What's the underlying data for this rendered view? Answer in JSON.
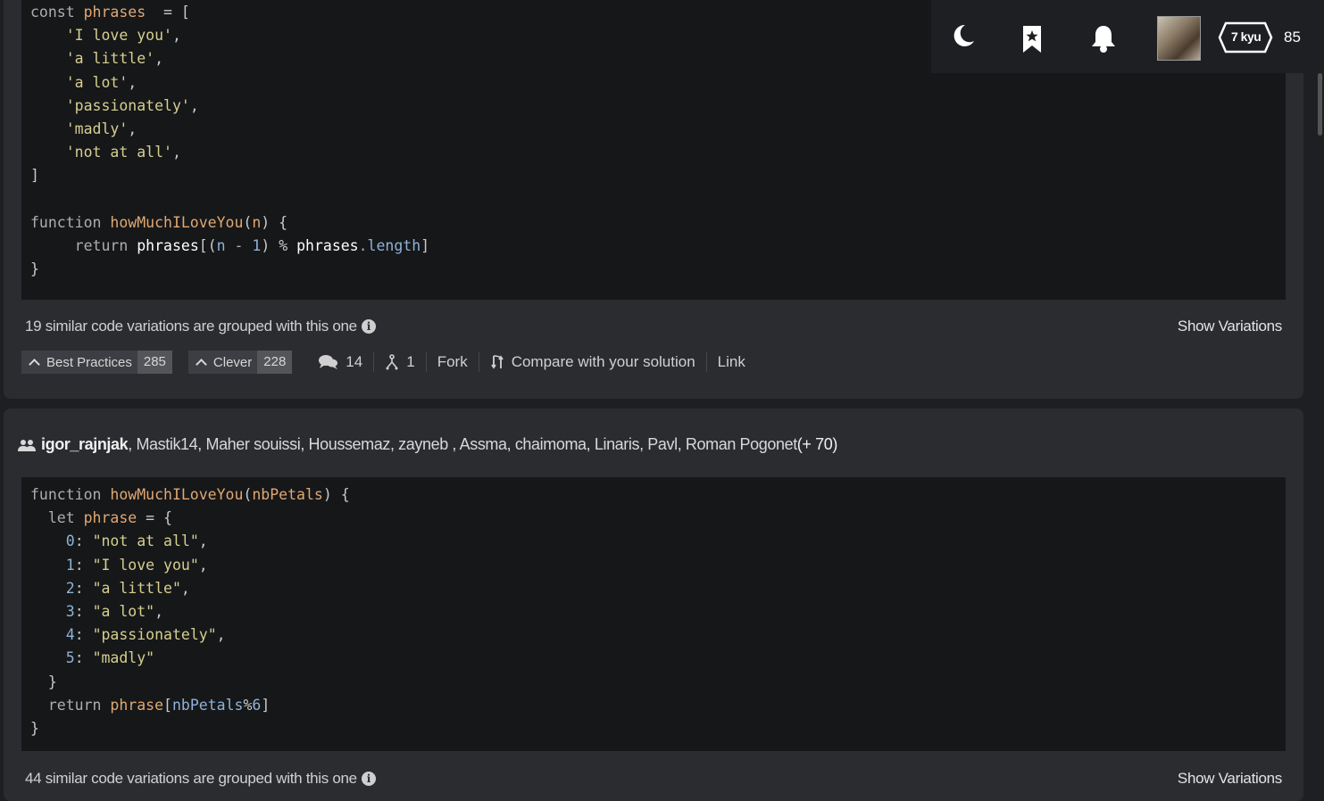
{
  "solutions": [
    {
      "code_lines": [
        [
          [
            "kw",
            "const "
          ],
          [
            "var",
            "phrases"
          ],
          [
            "",
            "  = ["
          ]
        ],
        [
          [
            "",
            "    "
          ],
          [
            "str",
            "'I love you'"
          ],
          [
            "",
            ","
          ]
        ],
        [
          [
            "",
            "    "
          ],
          [
            "str",
            "'a little'"
          ],
          [
            "",
            ","
          ]
        ],
        [
          [
            "",
            "    "
          ],
          [
            "str",
            "'a lot'"
          ],
          [
            "",
            ","
          ]
        ],
        [
          [
            "",
            "    "
          ],
          [
            "str",
            "'passionately'"
          ],
          [
            "",
            ","
          ]
        ],
        [
          [
            "",
            "    "
          ],
          [
            "str",
            "'madly'"
          ],
          [
            "",
            ","
          ]
        ],
        [
          [
            "",
            "    "
          ],
          [
            "str",
            "'not at all'"
          ],
          [
            "",
            ","
          ]
        ],
        [
          [
            "",
            "]"
          ]
        ],
        [
          [
            "",
            ""
          ]
        ],
        [
          [
            "kw",
            "function "
          ],
          [
            "fn",
            "howMuchILoveYou"
          ],
          [
            "",
            "("
          ],
          [
            "var",
            "n"
          ],
          [
            "",
            ") {"
          ]
        ],
        [
          [
            "",
            "     "
          ],
          [
            "kw",
            "return "
          ],
          [
            "var2",
            "phrases"
          ],
          [
            "",
            "[("
          ],
          [
            "prop",
            "n"
          ],
          [
            "",
            ""
          ],
          [
            "kw",
            " - "
          ],
          [
            "num",
            "1"
          ],
          [
            "",
            ") % "
          ],
          [
            "var2",
            "phrases"
          ],
          [
            "prop",
            ".length"
          ],
          [
            "",
            "]"
          ]
        ],
        [
          [
            "",
            "}"
          ]
        ]
      ],
      "variations_text": "19 similar code variations are grouped with this one",
      "show_variations": "Show Variations",
      "best_practices_label": "Best Practices",
      "best_practices_count": "285",
      "clever_label": "Clever",
      "clever_count": "228",
      "comments": "14",
      "forks": "1",
      "fork_label": "Fork",
      "compare_label": "Compare with your solution",
      "link_label": "Link"
    },
    {
      "authors_lead": "igor_rajnjak",
      "authors_rest": ", Mastik14, Maher souissi, Houssemaz, zayneb , Assma, chaimoma, Linaris, Pavl, Roman Pogonet",
      "authors_more": " (+ 70)",
      "code_lines": [
        [
          [
            "kw",
            "function "
          ],
          [
            "fn",
            "howMuchILoveYou"
          ],
          [
            "",
            "("
          ],
          [
            "var",
            "nbPetals"
          ],
          [
            "",
            ") {"
          ]
        ],
        [
          [
            "",
            "  "
          ],
          [
            "kw",
            "let "
          ],
          [
            "var",
            "phrase"
          ],
          [
            "",
            " = {"
          ]
        ],
        [
          [
            "",
            "    "
          ],
          [
            "num",
            "0"
          ],
          [
            "",
            ": "
          ],
          [
            "str",
            "\"not at all\""
          ],
          [
            "",
            ","
          ]
        ],
        [
          [
            "",
            "    "
          ],
          [
            "num",
            "1"
          ],
          [
            "",
            ": "
          ],
          [
            "str",
            "\"I love you\""
          ],
          [
            "",
            ","
          ]
        ],
        [
          [
            "",
            "    "
          ],
          [
            "num",
            "2"
          ],
          [
            "",
            ": "
          ],
          [
            "str",
            "\"a little\""
          ],
          [
            "",
            ","
          ]
        ],
        [
          [
            "",
            "    "
          ],
          [
            "num",
            "3"
          ],
          [
            "",
            ": "
          ],
          [
            "str",
            "\"a lot\""
          ],
          [
            "",
            ","
          ]
        ],
        [
          [
            "",
            "    "
          ],
          [
            "num",
            "4"
          ],
          [
            "",
            ": "
          ],
          [
            "str",
            "\"passionately\""
          ],
          [
            "",
            ","
          ]
        ],
        [
          [
            "",
            "    "
          ],
          [
            "num",
            "5"
          ],
          [
            "",
            ": "
          ],
          [
            "str",
            "\"madly\""
          ]
        ],
        [
          [
            "",
            "  }"
          ]
        ],
        [
          [
            "",
            "  "
          ],
          [
            "kw",
            "return "
          ],
          [
            "var",
            "phrase"
          ],
          [
            "",
            "["
          ],
          [
            "prop",
            "nbPetals"
          ],
          [
            "",
            "%"
          ],
          [
            "num",
            "6"
          ],
          [
            "",
            "]"
          ]
        ],
        [
          [
            "",
            "}"
          ]
        ]
      ],
      "variations_text": "44 similar code variations are grouped with this one",
      "show_variations": "Show Variations"
    }
  ],
  "nav": {
    "rank": "7 kyu",
    "honor": "85",
    "icons": [
      "moon-icon",
      "bookmark-icon",
      "bell-icon",
      "avatar",
      "rank-badge"
    ]
  }
}
